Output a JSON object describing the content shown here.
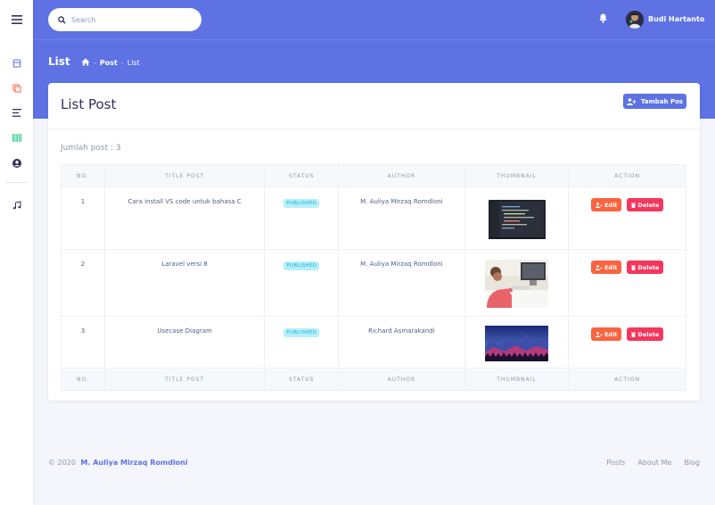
{
  "header": {
    "search_placeholder": "Search",
    "user_name": "Budi Hartanto"
  },
  "sidebar": {
    "items": [
      {
        "icon": "hamburger-menu-icon",
        "color": "#32325d"
      },
      {
        "icon": "shop-icon",
        "color": "#5e72e4"
      },
      {
        "icon": "copy-icon",
        "color": "#fb6340"
      },
      {
        "icon": "align-left-icon",
        "color": "#32325d"
      },
      {
        "icon": "barcode-icon",
        "color": "#2dce89"
      },
      {
        "icon": "user-circle-icon",
        "color": "#32325d"
      },
      {
        "icon": "music-note-icon",
        "color": "#32325d"
      }
    ]
  },
  "page": {
    "heading": "List",
    "breadcrumb": [
      "Post",
      "List"
    ]
  },
  "card": {
    "title": "List Post",
    "add_button": "Tambah Pos",
    "count_label": "Jumlah post : 3"
  },
  "table": {
    "columns": [
      "NO.",
      "TITLE POST",
      "STATUS",
      "AUTHOR",
      "THUMBNAIL",
      "ACTION"
    ],
    "rows": [
      {
        "no": "1",
        "title": "Cara install VS code untuk bahasa C",
        "status": "PUBLISHED",
        "author": "M. Auliya Mirzaq Romdloni",
        "thumbnail": "code-editor-thumbnail"
      },
      {
        "no": "2",
        "title": "Laravel versi 8",
        "status": "PUBLISHED",
        "author": "M. Auliya Mirzaq Romdloni",
        "thumbnail": "person-at-desk-thumbnail"
      },
      {
        "no": "3",
        "title": "Usecase Diagram",
        "status": "PUBLISHED",
        "author": "Richard Asmarakandi",
        "thumbnail": "mountain-landscape-thumbnail"
      }
    ],
    "edit_label": "Edit",
    "delete_label": "Delete"
  },
  "footer": {
    "copyright": "© 2020",
    "author": "M. Auliya Mirzaq Romdloni",
    "links": [
      "Posts",
      "About Me",
      "Blog"
    ]
  },
  "colors": {
    "primary": "#5e72e4",
    "warning": "#fb6340",
    "danger": "#f5365c",
    "info_badge_bg": "#b5f0fa",
    "info_badge_text": "#1aaee0"
  }
}
